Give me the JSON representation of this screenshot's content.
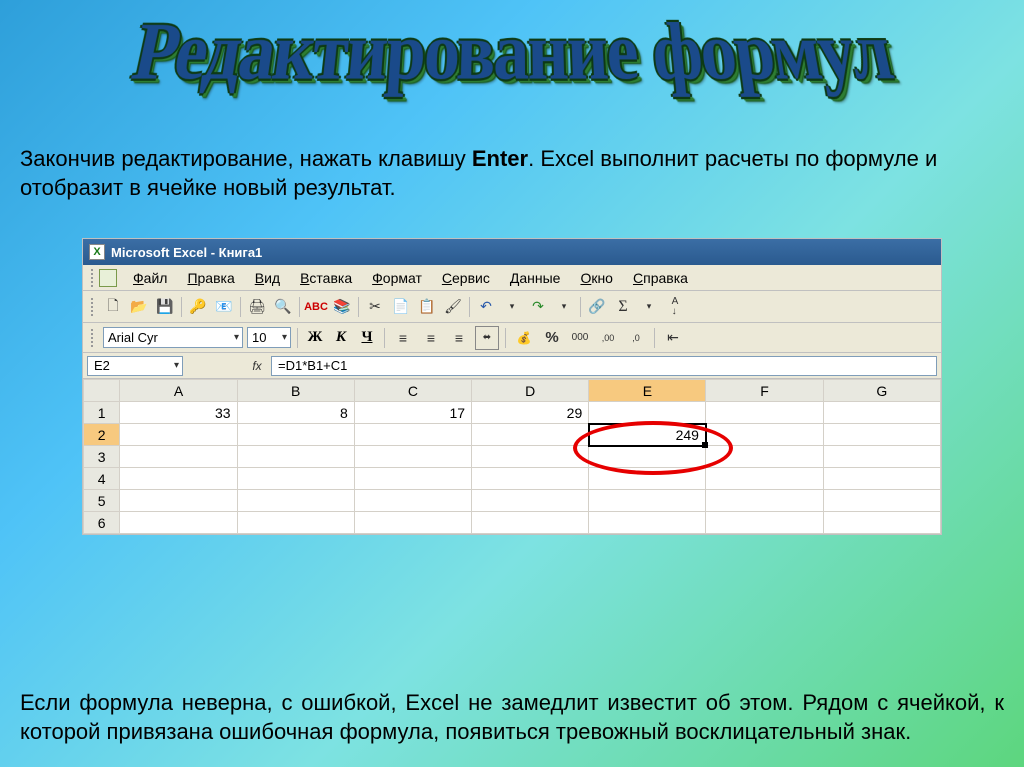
{
  "slide": {
    "title": "Редактирование формул",
    "intro_1": "Закончив редактирование, нажать клавишу ",
    "intro_bold": "Enter",
    "intro_2": ". Excel выполнит расчеты по формуле и отобразит в ячейке новый результат.",
    "outro": "Если формула неверна, с ошибкой, Excel не замедлит  известит об этом. Рядом с ячейкой, к которой привязана ошибочная формула, появиться тревожный восклицательный знак."
  },
  "window_title": "Microsoft Excel - Книга1",
  "menus": [
    "Файл",
    "Правка",
    "Вид",
    "Вставка",
    "Формат",
    "Сервис",
    "Данные",
    "Окно",
    "Справка"
  ],
  "font": {
    "name": "Arial Cyr",
    "size": "10"
  },
  "format_btns": {
    "bold": "Ж",
    "italic": "К",
    "underline": "Ч"
  },
  "toolbar_icons": {
    "new": "🗋",
    "open": "📂",
    "save": "💾",
    "perm": "🔑",
    "mail": "📧",
    "print": "🖨",
    "preview": "🔍",
    "spell": "✓",
    "research": "📚",
    "cut": "✂",
    "copy": "📄",
    "paste": "📋",
    "fmtpaint": "🖌",
    "undo": "↶",
    "redo": "↷",
    "link": "🔗",
    "sum": "Σ",
    "sort": "A↓"
  },
  "currency": "%",
  "thousand": "000",
  "decimals": {
    "inc": ",00",
    "dec": ",0"
  },
  "namebox": "E2",
  "fx_label": "fx",
  "formula": "=D1*B1+C1",
  "columns": [
    "A",
    "B",
    "C",
    "D",
    "E",
    "F",
    "G"
  ],
  "rows": [
    "1",
    "2",
    "3",
    "4",
    "5",
    "6"
  ],
  "cells": {
    "A1": "33",
    "B1": "8",
    "C1": "17",
    "D1": "29",
    "E2": "249"
  },
  "merge_icon": "⬌",
  "indent_icon": "⇤"
}
